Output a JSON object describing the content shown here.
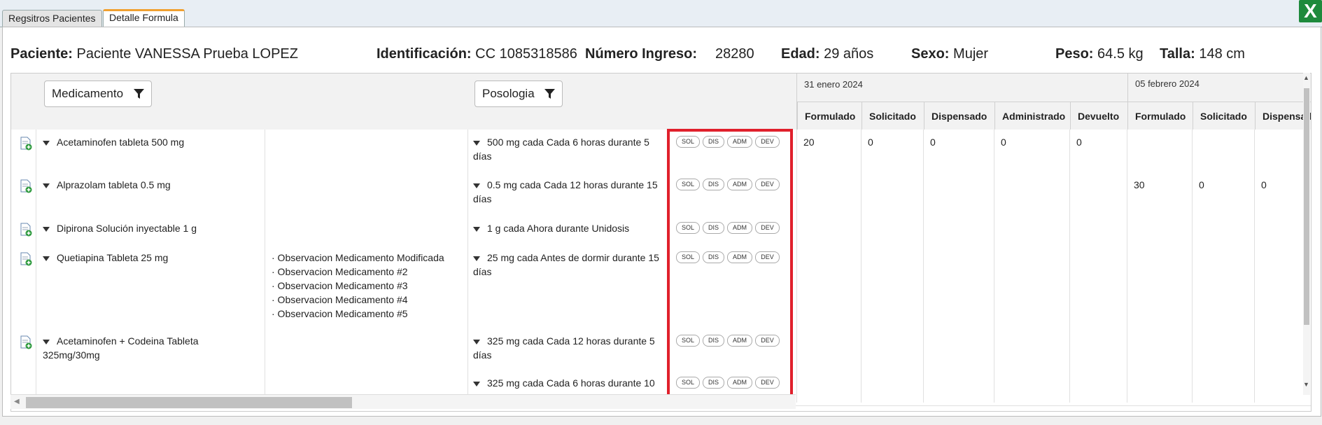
{
  "tabs": [
    {
      "label": "Regsitros Pacientes",
      "active": false
    },
    {
      "label": "Detalle Formula",
      "active": true
    }
  ],
  "close_label": "X",
  "patient": {
    "name_label": "Paciente:",
    "name_value": "Paciente VANESSA Prueba LOPEZ",
    "id_label": "Identificación:",
    "id_value": "CC 1085318586",
    "ingreso_label": "Número Ingreso:",
    "ingreso_value": "28280",
    "edad_label": "Edad:",
    "edad_value": "29 años",
    "sexo_label": "Sexo:",
    "sexo_value": "Mujer",
    "peso_label": "Peso:",
    "peso_value": "64.5 kg",
    "talla_label": "Talla:",
    "talla_value": "148 cm"
  },
  "filters": {
    "medicamento": "Medicamento",
    "posologia": "Posologia"
  },
  "dates": [
    "31 enero 2024",
    "05 febrero 2024"
  ],
  "subcols": [
    "Formulado",
    "Solicitado",
    "Dispensado",
    "Administrado",
    "Devuelto",
    "Formulado",
    "Solicitado",
    "Dispensado"
  ],
  "actions": [
    "SOL",
    "DIS",
    "ADM",
    "DEV"
  ],
  "rows": [
    {
      "med": "Acetaminofen tableta 500 mg",
      "obs": "",
      "pos": "500 mg cada Cada 6 horas durante 5 días",
      "vals": [
        "20",
        "0",
        "0",
        "0",
        "0",
        "",
        "",
        ""
      ]
    },
    {
      "med": "Alprazolam tableta 0.5 mg",
      "obs": "",
      "pos": "0.5 mg cada Cada 12 horas durante 15 días",
      "vals": [
        "",
        "",
        "",
        "",
        "",
        "30",
        "0",
        "0"
      ]
    },
    {
      "med": "Dipirona Solución inyectable 1 g",
      "obs": "",
      "pos": "1 g cada Ahora durante Unidosis",
      "vals": [
        "",
        "",
        "",
        "",
        "",
        "",
        "",
        ""
      ]
    },
    {
      "med": "Quetiapina Tableta 25 mg",
      "obs": [
        "· Observacion Medicamento Modificada",
        "· Observacion Medicamento #2",
        "· Observacion Medicamento #3",
        "· Observacion Medicamento #4",
        "· Observacion Medicamento #5"
      ],
      "pos": "25 mg cada Antes de dormir durante 15 días",
      "vals": [
        "",
        "",
        "",
        "",
        "",
        "",
        "",
        ""
      ]
    },
    {
      "med": "Acetaminofen + Codeina Tableta 325mg/30mg",
      "obs": "",
      "pos": "325 mg cada Cada 12 horas durante 5 días",
      "vals": [
        "",
        "",
        "",
        "",
        "",
        "",
        "",
        ""
      ]
    },
    {
      "med": "",
      "obs": "",
      "pos": "325 mg cada Cada 6 horas durante 10",
      "vals": [
        "",
        "",
        "",
        "",
        "",
        "",
        "",
        ""
      ]
    }
  ],
  "colors": {
    "accent_tab": "#f0a030",
    "close_bg": "#1e8a3c",
    "highlight": "#e0202c"
  }
}
